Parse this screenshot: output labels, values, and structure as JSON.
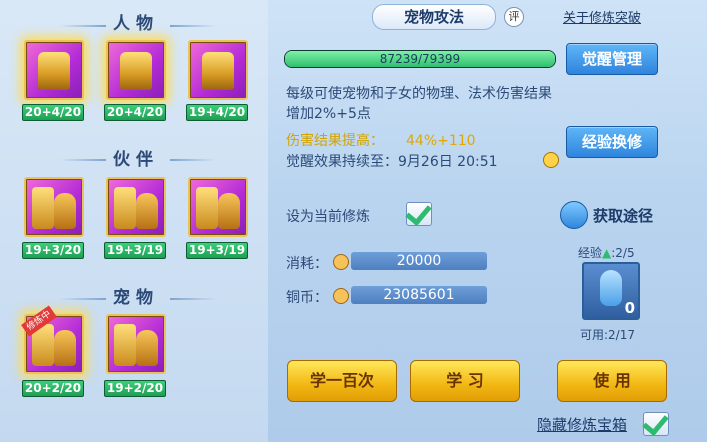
{
  "left": {
    "sections": [
      {
        "title": "人物",
        "items": [
          {
            "level": "20+4/20"
          },
          {
            "level": "20+4/20"
          },
          {
            "level": "19+4/20"
          }
        ]
      },
      {
        "title": "伙伴",
        "items": [
          {
            "level": "19+3/20"
          },
          {
            "level": "19+3/19"
          },
          {
            "level": "19+3/19"
          }
        ]
      },
      {
        "title": "宠物",
        "items": [
          {
            "level": "20+2/20",
            "badge": "修炼中"
          },
          {
            "level": "19+2/20"
          }
        ]
      }
    ]
  },
  "header": {
    "tab_title": "宠物攻法",
    "ping": "评",
    "link": "关于修炼突破"
  },
  "progress": {
    "text": "87239/79399",
    "ratio": 1.0
  },
  "buttons": {
    "awaken": "觉醒管理",
    "exchange": "经验换修",
    "learn100": "学一百次",
    "learn": "学 习",
    "use": "使 用"
  },
  "desc": "每级可使宠物和子女的物理、法术伤害结果增加2%+5点",
  "hurt": {
    "label": "伤害结果提高：",
    "value": "44%+110"
  },
  "expire": {
    "label": "觉醒效果持续至：",
    "value": "9月26日 20:51"
  },
  "set_current": "设为当前修炼",
  "get_path": "获取途径",
  "consume": {
    "label": "消耗：",
    "value": "20000"
  },
  "coin": {
    "label": "铜币：",
    "value": "23085601"
  },
  "exp": {
    "label": "经验",
    "value": ":2/5",
    "count": "0",
    "usable": "可用:2/17"
  },
  "hide_box": "隐藏修炼宝箱",
  "colors": {
    "slot": "#c12fd6",
    "level": "#2fbf6e",
    "gold": "#f2b712"
  }
}
